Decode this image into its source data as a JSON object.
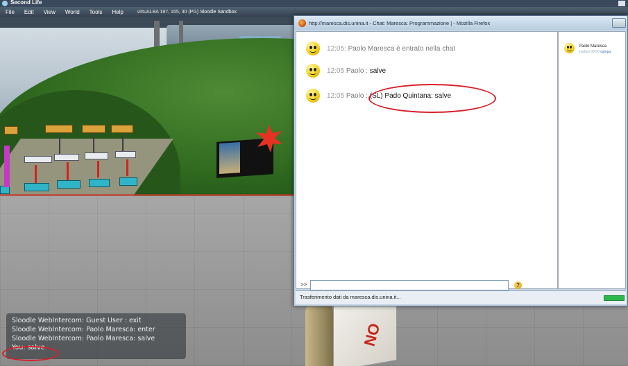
{
  "sl": {
    "window_title": "Second Life",
    "menu": [
      "File",
      "Edit",
      "View",
      "World",
      "Tools",
      "Help"
    ],
    "location_prefix": "virtuALBA 197, 165, 30 (PG)",
    "location_region": "Sloodle Sandbox",
    "chat_lines": [
      "Sloodle WebIntercom: Guest User : exit",
      "Sloodle WebIntercom: Paolo  Maresca: enter",
      "Sloodle WebIntercom: Paolo  Maresca: salve"
    ],
    "you_line": "You: salve",
    "crate_text": "NO"
  },
  "firefox": {
    "title": "http://maresca.dis.unina.it - Chat: Maresca: Programmazione | - Mozilla Firefox",
    "messages": [
      {
        "time": "12:05:",
        "who": "Paolo Maresca è entrato nella chat",
        "text": ""
      },
      {
        "time": "12:05",
        "who": "Paolo :",
        "text": "salve"
      },
      {
        "time": "12:05",
        "who": "Paolo :",
        "text": "(SL) Pado Quintana: salve"
      }
    ],
    "user": {
      "name": "Paolo Maresca",
      "status": "inattivo 00:00",
      "link": "campa"
    },
    "input_prompt": ">>",
    "input_value": "",
    "help_label": "?",
    "status_text": "Trasferimento dati da maresca.dis.unina.it..."
  },
  "colors": {
    "annotation": "#d6202a",
    "progress": "#2bb84a"
  }
}
